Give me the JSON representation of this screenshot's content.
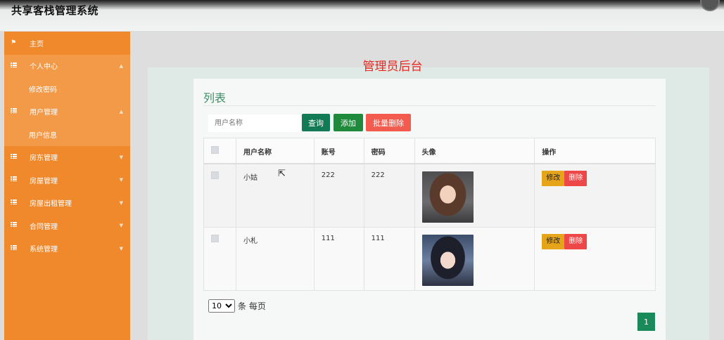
{
  "header": {
    "title": "共享客栈管理系统"
  },
  "sidebar": {
    "items": [
      {
        "label": "主页"
      },
      {
        "label": "个人中心"
      },
      {
        "label": "修改密码"
      },
      {
        "label": "用户管理"
      },
      {
        "label": "用户信息"
      },
      {
        "label": "房东管理"
      },
      {
        "label": "房屋管理"
      },
      {
        "label": "房屋出租管理"
      },
      {
        "label": "合同管理"
      },
      {
        "label": "系统管理"
      }
    ],
    "accent_color": "#f0882c"
  },
  "main": {
    "heading": "管理员后台",
    "card_title": "列表",
    "search": {
      "placeholder": "用户名称",
      "value": ""
    },
    "buttons": {
      "search": "查询",
      "add": "添加",
      "bulk_delete": "批量删除"
    },
    "table": {
      "columns": [
        "用户名称",
        "账号",
        "密码",
        "头像",
        "操作"
      ],
      "rows": [
        {
          "name": "小姑",
          "account": "222",
          "password": "222",
          "avatar": "avatar-woman-brown-hair",
          "edit": "修改",
          "delete": "删除"
        },
        {
          "name": "小札",
          "account": "111",
          "password": "111",
          "avatar": "avatar-woman-black-hair",
          "edit": "修改",
          "delete": "删除"
        }
      ]
    },
    "pagination": {
      "page_size": "10",
      "page_size_options": [
        "10"
      ],
      "page_size_suffix": "条 每页",
      "current_page": "1"
    }
  }
}
